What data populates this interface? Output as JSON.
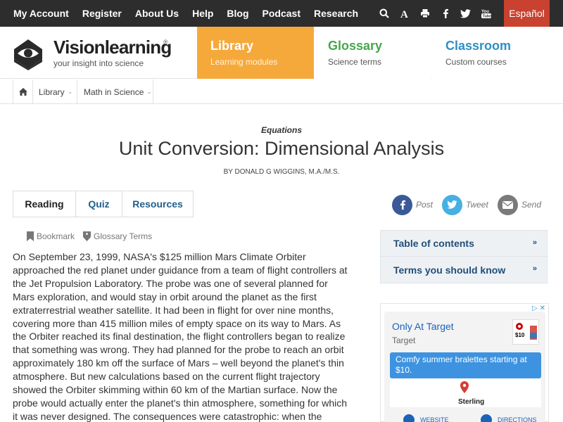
{
  "topnav": {
    "links": [
      "My Account",
      "Register",
      "About Us",
      "Help",
      "Blog",
      "Podcast",
      "Research"
    ],
    "icons": [
      "search-icon",
      "font-size-icon",
      "print-icon",
      "facebook-icon",
      "twitter-icon",
      "youtube-icon"
    ],
    "language_button": "Español"
  },
  "header": {
    "logo_word": "Visionlearning",
    "logo_reg": "®",
    "tagline": "your insight into science",
    "tabs": [
      {
        "title": "Library",
        "subtitle": "Learning modules"
      },
      {
        "title": "Glossary",
        "subtitle": "Science terms"
      },
      {
        "title": "Classroom",
        "subtitle": "Custom courses"
      }
    ]
  },
  "breadcrumb": {
    "items": [
      "Library",
      "Math in Science"
    ]
  },
  "article": {
    "category": "Equations",
    "title": "Unit Conversion: Dimensional Analysis",
    "byline": "BY DONALD G WIGGINS, M.A./M.S.",
    "tabs": [
      "Reading",
      "Quiz",
      "Resources"
    ],
    "tools": [
      "Bookmark",
      "Glossary Terms"
    ],
    "body": "On September 23, 1999, NASA's $125 million Mars Climate Orbiter approached the red planet under guidance from a team of flight controllers at the Jet Propulsion Laboratory. The probe was one of several planned for Mars exploration, and would stay in orbit around the planet as the first extraterrestrial weather satellite. It had been in flight for over nine months, covering more than 415 million miles of empty space on its way to Mars. As the Orbiter reached its final destination, the flight controllers began to realize that something was wrong. They had planned for the probe to reach an orbit approximately 180 km off the surface of Mars – well beyond the planet's thin atmosphere. But new calculations based on the current flight trajectory showed the Orbiter skimming within 60 km of the Martian surface. Now the probe would actually enter the planet's thin atmosphere, something for which it was never designed. The consequences were catastrophic: when the scientists and engineers commanding the probe lost"
  },
  "share": [
    "Post",
    "Tweet",
    "Send"
  ],
  "sidebar": {
    "items": [
      "Table of contents",
      "Terms you should know"
    ]
  },
  "ad": {
    "title": "Only At Target",
    "advertiser": "Target",
    "promo": "Comfy summer bralettes starting at $10.",
    "map_label": "Sterling",
    "buttons": [
      "WEBSITE",
      "DIRECTIONS"
    ]
  },
  "colors": {
    "topbar": "#2d2d2d",
    "language": "#c9412f",
    "library": "#f6a93b",
    "glossary": "#46a84a",
    "classroom": "#2f8fc4",
    "link": "#1f5f8b"
  }
}
